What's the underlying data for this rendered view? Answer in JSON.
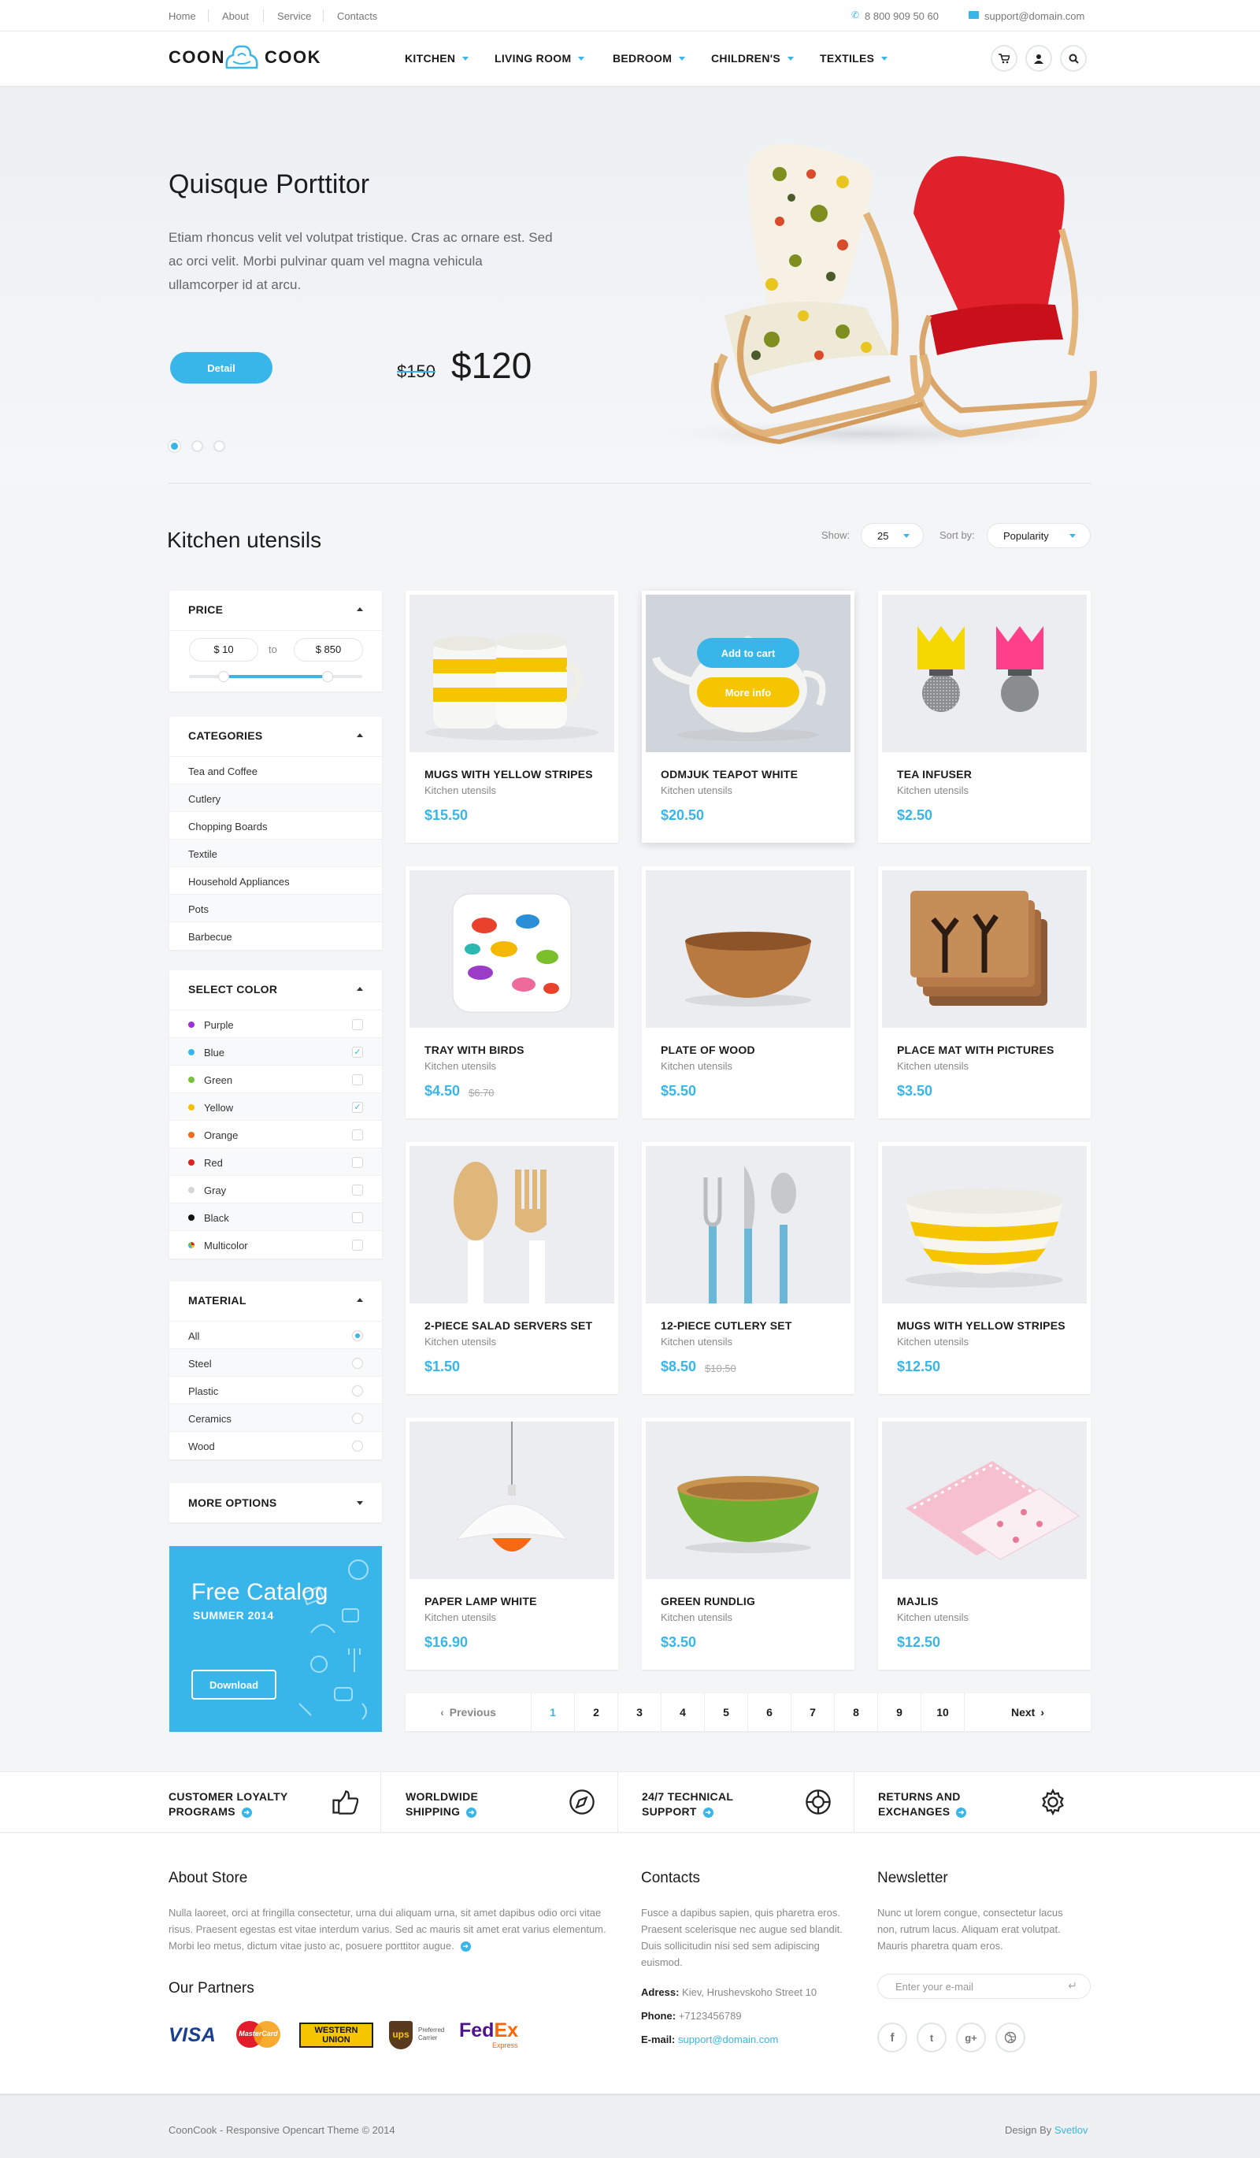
{
  "topbar": {
    "links": [
      "Home",
      "About",
      "Service",
      "Contacts"
    ],
    "phone": "8 800 909 50 60",
    "email": "support@domain.com"
  },
  "header": {
    "logo_left": "COON",
    "logo_right": "COOK",
    "nav": [
      "KITCHEN",
      "LIVING ROOM",
      "BEDROOM",
      "CHILDREN'S",
      "TEXTILES"
    ],
    "icons": [
      "cart-icon",
      "user-icon",
      "search-icon"
    ]
  },
  "hero": {
    "title": "Quisque Porttitor",
    "text": "Etiam rhoncus velit vel volutpat tristique. Cras ac ornare est. Sed ac orci velit. Morbi pulvinar quam vel magna vehicula ullamcorper id at arcu.",
    "button": "Detail",
    "old_price": "$150",
    "price": "$120",
    "slides": 3,
    "active_slide": 1
  },
  "catalog": {
    "title": "Kitchen utensils",
    "show_label": "Show:",
    "show_value": "25",
    "sort_label": "Sort by:",
    "sort_value": "Popularity"
  },
  "filters": {
    "price": {
      "title": "PRICE",
      "from": "$ 10",
      "to_label": "to",
      "to": "$ 850",
      "range_fraction": [
        0.2,
        0.8
      ]
    },
    "categories": {
      "title": "CATEGORIES",
      "items": [
        "Tea and Coffee",
        "Cutlery",
        "Chopping Boards",
        "Textile",
        "Household Appliances",
        "Pots",
        "Barbecue"
      ]
    },
    "color": {
      "title": "SELECT COLOR",
      "items": [
        {
          "name": "Purple",
          "color": "#9b30d9",
          "checked": false
        },
        {
          "name": "Blue",
          "color": "#38b6e9",
          "checked": true
        },
        {
          "name": "Green",
          "color": "#78c03c",
          "checked": false
        },
        {
          "name": "Yellow",
          "color": "#f5c000",
          "checked": true
        },
        {
          "name": "Orange",
          "color": "#f06a1a",
          "checked": false
        },
        {
          "name": "Red",
          "color": "#e0201e",
          "checked": false
        },
        {
          "name": "Gray",
          "color": "#d5d5d5",
          "checked": false
        },
        {
          "name": "Black",
          "color": "#111111",
          "checked": false
        },
        {
          "name": "Multicolor",
          "color": "multi",
          "checked": false
        }
      ]
    },
    "material": {
      "title": "MATERIAL",
      "items": [
        {
          "name": "All",
          "selected": true
        },
        {
          "name": "Steel",
          "selected": false
        },
        {
          "name": "Plastic",
          "selected": false
        },
        {
          "name": "Ceramics",
          "selected": false
        },
        {
          "name": "Wood",
          "selected": false
        }
      ]
    },
    "more": {
      "title": "MORE OPTIONS"
    }
  },
  "promo": {
    "title": "Free Catalog",
    "subtitle": "SUMMER 2014",
    "button": "Download"
  },
  "products": [
    {
      "name": "MUGS WITH YELLOW STRIPES",
      "cat": "Kitchen utensils",
      "price": "$15.50",
      "old": "",
      "img": "mugs"
    },
    {
      "name": "ODMJUK TEAPOT WHITE",
      "cat": "Kitchen utensils",
      "price": "$20.50",
      "old": "",
      "img": "teapot",
      "hover": true
    },
    {
      "name": "TEA INFUSER",
      "cat": "Kitchen utensils",
      "price": "$2.50",
      "old": "",
      "img": "infuser"
    },
    {
      "name": "TRAY WITH BIRDS",
      "cat": "Kitchen utensils",
      "price": "$4.50",
      "old": "$6.70",
      "img": "tray"
    },
    {
      "name": "PLATE OF WOOD",
      "cat": "Kitchen utensils",
      "price": "$5.50",
      "old": "",
      "img": "bowl"
    },
    {
      "name": "PLACE MAT WITH PICTURES",
      "cat": "Kitchen utensils",
      "price": "$3.50",
      "old": "",
      "img": "mats"
    },
    {
      "name": "2-PIECE SALAD SERVERS SET",
      "cat": "Kitchen utensils",
      "price": "$1.50",
      "old": "",
      "img": "servers"
    },
    {
      "name": "12-PIECE CUTLERY SET",
      "cat": "Kitchen utensils",
      "price": "$8.50",
      "old": "$10.50",
      "img": "cutlery"
    },
    {
      "name": "MUGS WITH YELLOW STRIPES",
      "cat": "Kitchen utensils",
      "price": "$12.50",
      "old": "",
      "img": "yellowbowl"
    },
    {
      "name": "PAPER LAMP WHITE",
      "cat": "Kitchen utensils",
      "price": "$16.90",
      "old": "",
      "img": "lamp"
    },
    {
      "name": "GREEN RUNDLIG",
      "cat": "Kitchen utensils",
      "price": "$3.50",
      "old": "",
      "img": "greenbowl"
    },
    {
      "name": "MAJLIS",
      "cat": "Kitchen utensils",
      "price": "$12.50",
      "old": "",
      "img": "napkins"
    }
  ],
  "hover_buttons": {
    "add": "Add to cart",
    "info": "More info"
  },
  "pagination": {
    "prev": "Previous",
    "next": "Next",
    "pages": [
      "1",
      "2",
      "3",
      "4",
      "5",
      "6",
      "7",
      "8",
      "9",
      "10"
    ],
    "current": "1"
  },
  "features": [
    {
      "line1": "CUSTOMER LOYALTY",
      "line2": "PROGRAMS",
      "icon": "thumbs-up-icon"
    },
    {
      "line1": "WORLDWIDE",
      "line2": "SHIPPING",
      "icon": "compass-icon"
    },
    {
      "line1": "24/7 TECHNICAL",
      "line2": "SUPPORT",
      "icon": "lifebuoy-icon"
    },
    {
      "line1": "RETURNS AND",
      "line2": "EXCHANGES",
      "icon": "gear-icon"
    }
  ],
  "footer": {
    "about_title": "About Store",
    "about_text": "Nulla laoreet, orci at fringilla consectetur, urna dui aliquam urna, sit amet dapibus odio orci vitae risus. Praesent egestas est vitae interdum varius. Sed ac mauris sit amet erat varius elementum. Morbi leo metus, dictum vitae justo ac, posuere porttitor augue.",
    "partners_title": "Our Partners",
    "partners": {
      "visa": "VISA",
      "mastercard": "MasterCard",
      "wu1": "WESTERN",
      "wu2": "UNION",
      "ups": "ups",
      "ups_note1": "Preferred",
      "ups_note2": "Carrier",
      "fedex1": "Fed",
      "fedex2": "Ex",
      "fedex3": "Express"
    },
    "contacts_title": "Contacts",
    "contacts_text": "Fusce a dapibus sapien, quis pharetra eros. Praesent scelerisque nec augue sed blandit. Duis sollicitudin nisi sed sem adipiscing euismod.",
    "address_label": "Adress:",
    "address": "Kiev, Hrushevskoho Street 10",
    "phone_label": "Phone:",
    "phone": "+7123456789",
    "email_label": "E-mail:",
    "email": "support@domain.com",
    "newsletter_title": "Newsletter",
    "newsletter_text": "Nunc ut lorem congue, consectetur lacus non, rutrum lacus. Aliquam erat volutpat. Mauris pharetra quam eros.",
    "newsletter_placeholder": "Enter your e-mail",
    "social": [
      "f",
      "t",
      "g+",
      "dribbble"
    ]
  },
  "bottom": {
    "copyright": "CoonCook - Responsive Opencart Theme © 2014",
    "design_by": "Design By",
    "designer": "Svetlov"
  },
  "colors": {
    "accent": "#38b6e9",
    "yellow": "#f5c500"
  }
}
